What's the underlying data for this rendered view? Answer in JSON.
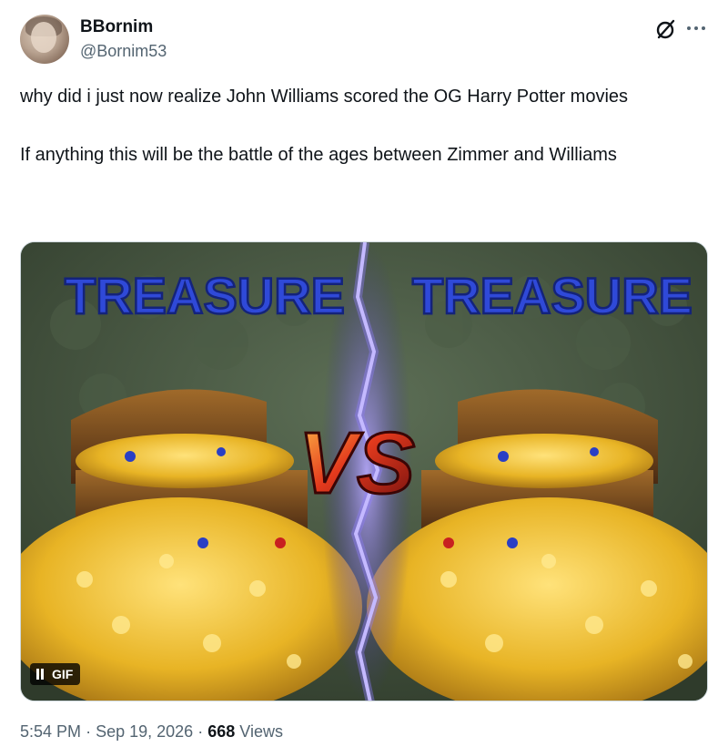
{
  "author": {
    "display_name": "BBornim",
    "handle": "@Bornim53",
    "avatar_icon": "avatar"
  },
  "header_icons": {
    "grok": "grok-icon",
    "more": "more-icon"
  },
  "tweet": {
    "paragraphs": [
      "why did i just now realize John Williams scored the OG Harry Potter movies",
      "If anything this will be the battle of the ages between Zimmer and Williams"
    ]
  },
  "media": {
    "type": "gif",
    "left_caption": "TREASURE",
    "right_caption": "TREASURE",
    "center_text": "VS",
    "badge_label": "GIF"
  },
  "meta": {
    "time": "5:54 PM",
    "separator": "·",
    "date": "Sep 19, 2026",
    "views_count": "668",
    "views_label": "Views"
  },
  "colors": {
    "text": "#0f1419",
    "secondary_text": "#536471",
    "caption_blue": "#2f49d8",
    "lightning": "#8f7cff",
    "gold": "#e8b425"
  }
}
